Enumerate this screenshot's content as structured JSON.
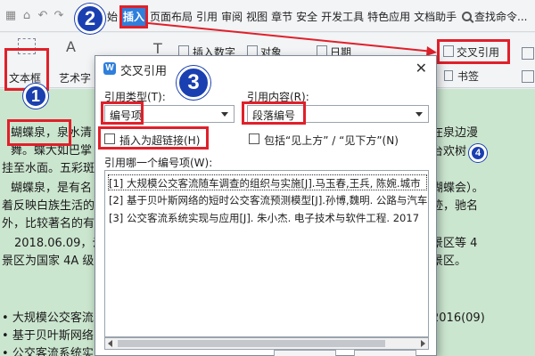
{
  "menubar": {
    "tabs": [
      "始",
      "插入",
      "页面布局",
      "引用",
      "审阅",
      "视图",
      "章节",
      "安全",
      "开发工具",
      "特色应用",
      "文档助手"
    ],
    "active_tab": "插入",
    "search_label": "查找命令..."
  },
  "ribbon": {
    "text_box": "文本框",
    "art_text": "艺术字",
    "insert_number": "插入数字",
    "object": "对象",
    "date": "日期",
    "cross_reference": "交叉引用",
    "bookmark": "书签"
  },
  "document": {
    "lines": [
      "蝴蝶泉，泉水清",
      "舞。蝶大如巴掌",
      "挂至水面。五彩斑",
      "蝴蝶泉，是有名",
      "着反映白族生活的",
      "外，比较著名的有",
      "2018.06.09，云南",
      "景区为国家 4A 级",
      "大规模公交客流",
      "基于贝叶斯网络",
      "公交客流系统实"
    ],
    "right_lines": [
      "在泉边漫",
      "台欢树",
      "蝴蝶会）。",
      "迹，驰名",
      "景区等 4",
      "景区。",
      "2016(09)"
    ],
    "highlight_word": "蝴蝶泉"
  },
  "callouts": {
    "one": "1",
    "two": "2",
    "three": "3",
    "four": "4"
  },
  "dialog": {
    "title": "交叉引用",
    "logo": "W",
    "close": "✕",
    "ref_type_label": "引用类型(T):",
    "ref_type_value": "编号项",
    "ref_content_label": "引用内容(R):",
    "ref_content_value": "段落编号",
    "insert_hyperlink": "插入为超链接(H)",
    "include_above_below": "包括“见上方” / “见下方”(N)",
    "which_item_label": "引用哪一个编号项(W):",
    "items": [
      "[1] 大规模公交客流随车调查的组织与实施[J].马玉春,王兵,  陈婉.城市",
      "[2] 基于贝叶斯网络的短时公交客流预测模型[J].孙博,魏明.  公路与汽车",
      "[3] 公交客流系统实现与应用[J]. 朱小杰.  电子技术与软件工程. 2017"
    ]
  },
  "colors": {
    "accent": "#2f7fdc",
    "callout_red": "#e0202a",
    "badge_blue": "#1a3fb0",
    "doc_bg": "#cbe6cf"
  }
}
